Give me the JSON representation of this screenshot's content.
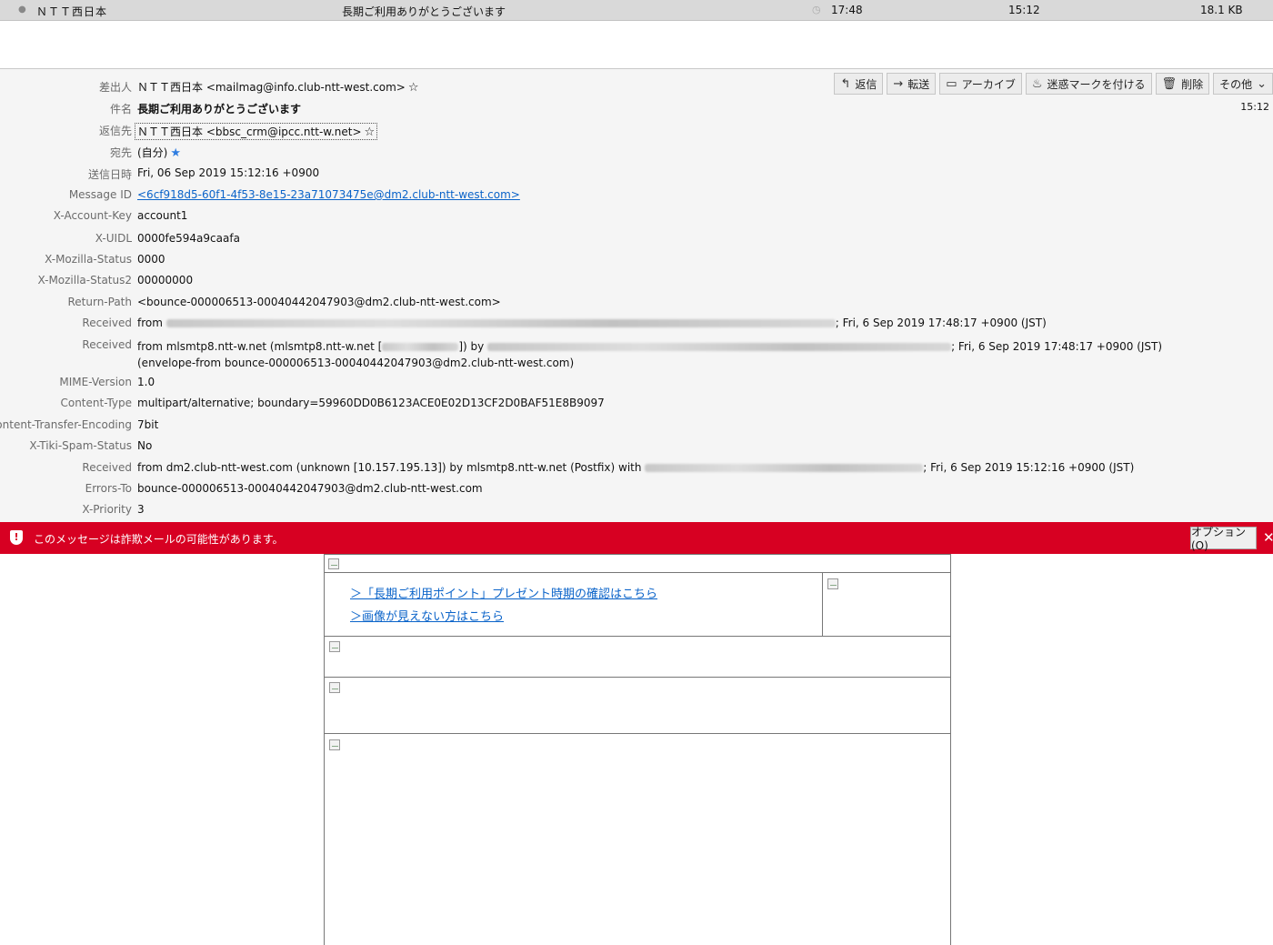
{
  "message_list": {
    "sender": "ＮＴＴ西日本",
    "subject": "長期ご利用ありがとうございます",
    "received_time": "17:48",
    "date": "15:12",
    "size": "18.1 KB",
    "dot_icon": "unread-dot-icon",
    "clock_icon": "clock-icon"
  },
  "toolbar": {
    "reply": "返信",
    "forward": "転送",
    "archive": "アーカイブ",
    "junk": "迷惑マークを付ける",
    "delete": "削除",
    "other": "その他"
  },
  "header_time": "15:12",
  "headers": {
    "from": {
      "label": "差出人",
      "value": "ＮＴＴ西日本 <mailmag@info.club-ntt-west.com>"
    },
    "subject": {
      "label": "件名",
      "value": "長期ご利用ありがとうございます"
    },
    "reply_to": {
      "label": "返信先",
      "value": "ＮＴＴ西日本 <bbsc_crm@ipcc.ntt-w.net>"
    },
    "to": {
      "label": "宛先",
      "value": "(自分)"
    },
    "date": {
      "label": "送信日時",
      "value": "Fri, 06 Sep 2019 15:12:16 +0900"
    },
    "message_id": {
      "label": "Message ID",
      "value": "<6cf918d5-60f1-4f53-8e15-23a71073475e@dm2.club-ntt-west.com>"
    },
    "account_key": {
      "label": "X-Account-Key",
      "value": "account1"
    },
    "uidl": {
      "label": "X-UIDL",
      "value": "0000fe594a9caafa"
    },
    "mozilla_status": {
      "label": "X-Mozilla-Status",
      "value": "0000"
    },
    "mozilla_status2": {
      "label": "X-Mozilla-Status2",
      "value": "00000000"
    },
    "return_path": {
      "label": "Return-Path",
      "value": "<bounce-000006513-00040442047903@dm2.club-ntt-west.com>"
    },
    "received1": {
      "label": "Received",
      "prefix": "from",
      "suffix": "; Fri, 6 Sep 2019 17:48:17 +0900 (JST)"
    },
    "received2": {
      "label": "Received",
      "prefix": "from mlsmtp8.ntt-w.net (mlsmtp8.ntt-w.net [",
      "middle": "]) by",
      "suffix": "; Fri, 6 Sep 2019 17:48:17 +0900 (JST) (envelope-from bounce-000006513-00040442047903@dm2.club-ntt-west.com)"
    },
    "mime_version": {
      "label": "MIME-Version",
      "value": "1.0"
    },
    "content_type": {
      "label": "Content-Type",
      "value": "multipart/alternative; boundary=59960DD0B6123ACE0E02D13CF2D0BAF51E8B9097"
    },
    "cte": {
      "label": "Content-Transfer-Encoding",
      "value": "7bit"
    },
    "spam_status": {
      "label": "X-Tiki-Spam-Status",
      "value": "No"
    },
    "received3": {
      "label": "Received",
      "prefix": "from dm2.club-ntt-west.com (unknown [10.157.195.13]) by mlsmtp8.ntt-w.net (Postfix) with",
      "suffix": "; Fri, 6 Sep 2019 15:12:16 +0900 (JST)"
    },
    "errors_to": {
      "label": "Errors-To",
      "value": "bounce-000006513-00040442047903@dm2.club-ntt-west.com"
    },
    "priority": {
      "label": "X-Priority",
      "value": "3"
    }
  },
  "scam_bar": {
    "message": "このメッセージは詐欺メールの可能性があります。",
    "options": "オプション(O)",
    "bg_color": "#d70022"
  },
  "body": {
    "link1": "＞「長期ご利用ポイント」プレゼント時期の確認はこちら",
    "link2": "＞画像が見えない方はこちら"
  }
}
